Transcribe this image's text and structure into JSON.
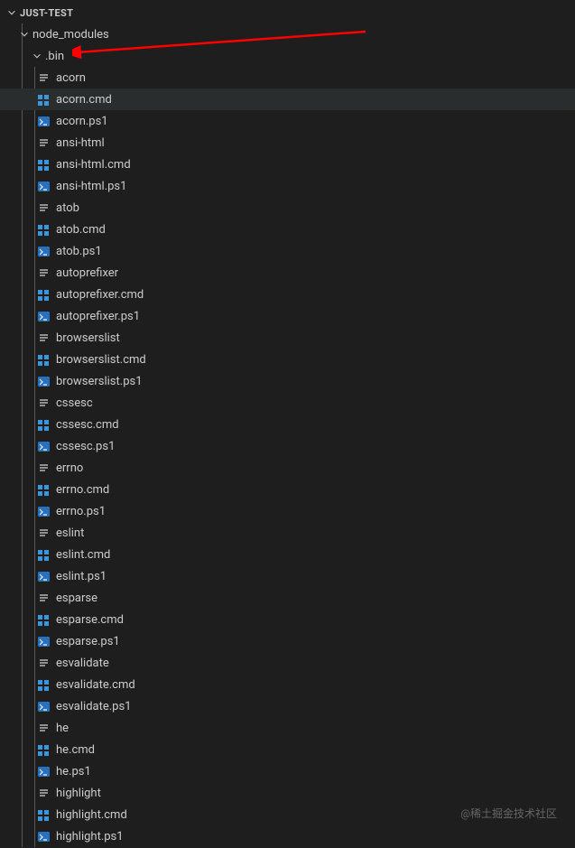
{
  "root": {
    "label": "JUST-TEST"
  },
  "folders": [
    {
      "label": "node_modules",
      "indent": 1
    },
    {
      "label": ".bin",
      "indent": 2
    }
  ],
  "files": [
    {
      "name": "acorn",
      "icon": "text"
    },
    {
      "name": "acorn.cmd",
      "icon": "cmd",
      "hovered": true
    },
    {
      "name": "acorn.ps1",
      "icon": "ps1"
    },
    {
      "name": "ansi-html",
      "icon": "text"
    },
    {
      "name": "ansi-html.cmd",
      "icon": "cmd"
    },
    {
      "name": "ansi-html.ps1",
      "icon": "ps1"
    },
    {
      "name": "atob",
      "icon": "text"
    },
    {
      "name": "atob.cmd",
      "icon": "cmd"
    },
    {
      "name": "atob.ps1",
      "icon": "ps1"
    },
    {
      "name": "autoprefixer",
      "icon": "text"
    },
    {
      "name": "autoprefixer.cmd",
      "icon": "cmd"
    },
    {
      "name": "autoprefixer.ps1",
      "icon": "ps1"
    },
    {
      "name": "browserslist",
      "icon": "text"
    },
    {
      "name": "browserslist.cmd",
      "icon": "cmd"
    },
    {
      "name": "browserslist.ps1",
      "icon": "ps1"
    },
    {
      "name": "cssesc",
      "icon": "text"
    },
    {
      "name": "cssesc.cmd",
      "icon": "cmd"
    },
    {
      "name": "cssesc.ps1",
      "icon": "ps1"
    },
    {
      "name": "errno",
      "icon": "text"
    },
    {
      "name": "errno.cmd",
      "icon": "cmd"
    },
    {
      "name": "errno.ps1",
      "icon": "ps1"
    },
    {
      "name": "eslint",
      "icon": "text"
    },
    {
      "name": "eslint.cmd",
      "icon": "cmd"
    },
    {
      "name": "eslint.ps1",
      "icon": "ps1"
    },
    {
      "name": "esparse",
      "icon": "text"
    },
    {
      "name": "esparse.cmd",
      "icon": "cmd"
    },
    {
      "name": "esparse.ps1",
      "icon": "ps1"
    },
    {
      "name": "esvalidate",
      "icon": "text"
    },
    {
      "name": "esvalidate.cmd",
      "icon": "cmd"
    },
    {
      "name": "esvalidate.ps1",
      "icon": "ps1"
    },
    {
      "name": "he",
      "icon": "text"
    },
    {
      "name": "he.cmd",
      "icon": "cmd"
    },
    {
      "name": "he.ps1",
      "icon": "ps1"
    },
    {
      "name": "highlight",
      "icon": "text"
    },
    {
      "name": "highlight.cmd",
      "icon": "cmd"
    },
    {
      "name": "highlight.ps1",
      "icon": "ps1"
    }
  ],
  "watermark": "@稀土掘金技术社区"
}
